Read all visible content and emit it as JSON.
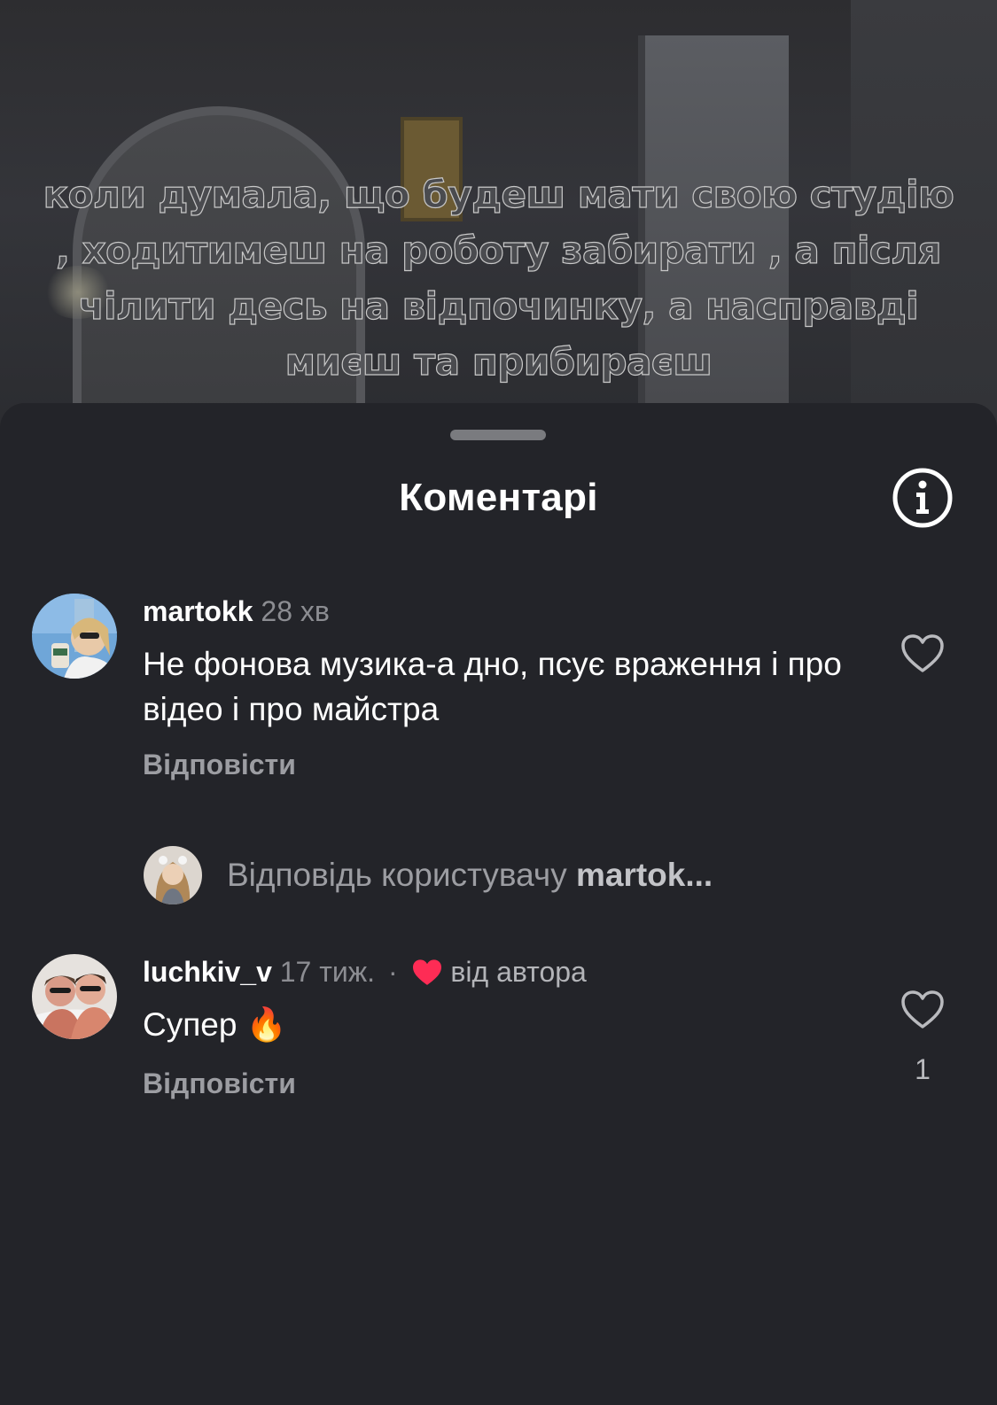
{
  "video": {
    "caption": "коли думала, що будеш мати свою студію , ходитимеш на роботу забирати , а після чілити десь на відпочинку, а насправді миєш та прибираєш"
  },
  "sheet": {
    "title": "Коментарі",
    "info_icon": "info-circle-icon"
  },
  "comments": [
    {
      "username": "martokk",
      "time": "28 хв",
      "text": "Не фонова музика-а дно, псує враження і про відео і про майстра",
      "reply_label": "Відповісти",
      "like_icon": "heart-outline-icon",
      "like_count": ""
    },
    {
      "username": "luchkiv_v",
      "time": "17 тиж.",
      "separator": "·",
      "author_like_icon": "heart-filled-icon",
      "author_like_label": "від автора",
      "text": "Супер 🔥",
      "reply_label": "Відповісти",
      "like_icon": "heart-outline-icon",
      "like_count": "1"
    }
  ],
  "reply_composer": {
    "prefix": "Відповідь користувачу",
    "target": "martok..."
  },
  "colors": {
    "sheet_bg": "#232429",
    "heart_red": "#fe2c55",
    "text_primary": "#ffffff",
    "text_secondary": "#8c8d92"
  }
}
